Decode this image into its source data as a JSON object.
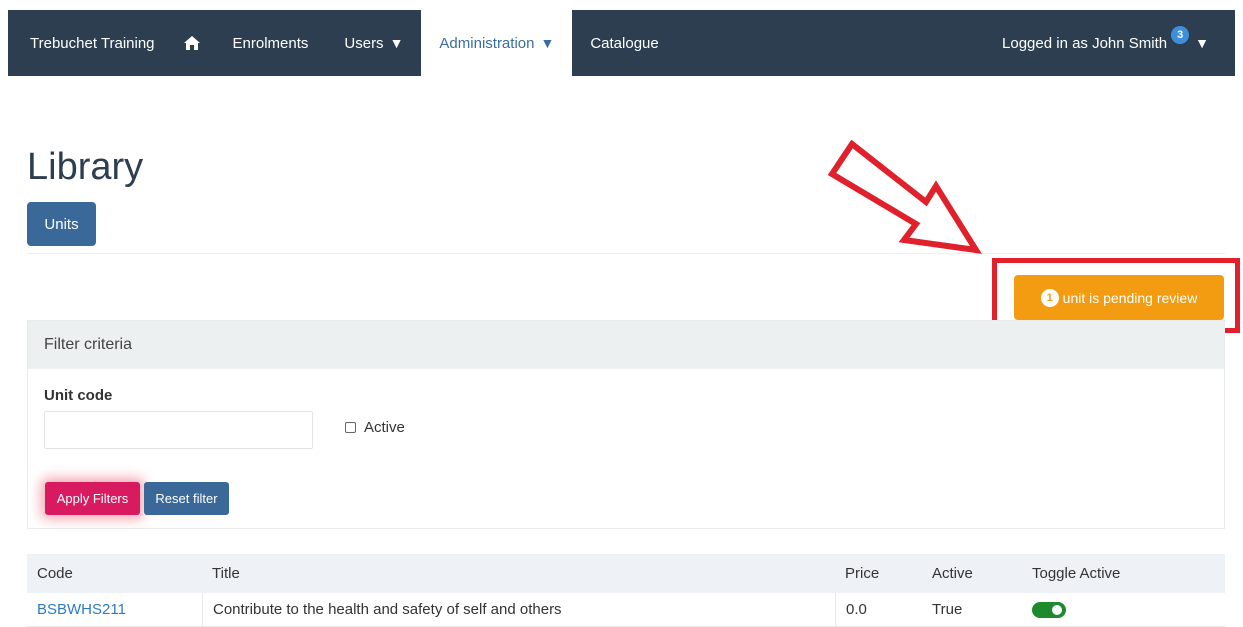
{
  "navbar": {
    "brand": "Trebuchet Training",
    "home_icon": "home-icon",
    "items": [
      {
        "label": "Enrolments",
        "caret": ""
      },
      {
        "label": "Users",
        "caret": "▼"
      },
      {
        "label": "Administration",
        "caret": "▼"
      },
      {
        "label": "Catalogue",
        "caret": ""
      }
    ],
    "user_label": "Logged in as John Smith",
    "notification_count": "3",
    "user_caret": "▼"
  },
  "page": {
    "title": "Library",
    "units_button": "Units"
  },
  "pending": {
    "count": "1",
    "label": "unit is pending review"
  },
  "filter": {
    "header": "Filter criteria",
    "unit_code_label": "Unit code",
    "unit_code_value": "",
    "active_label": "Active",
    "apply_button": "Apply Filters",
    "reset_button": "Reset filter"
  },
  "table": {
    "headers": [
      "Code",
      "Title",
      "Price",
      "Active",
      "Toggle Active"
    ],
    "rows": [
      {
        "code": "BSBWHS211",
        "title": "Contribute to the health and safety of self and others",
        "price": "0.0",
        "active": "True",
        "toggle": true
      }
    ]
  },
  "colors": {
    "navbar": "#2c3e50",
    "primary": "#3a6898",
    "warning": "#f39c12",
    "highlight": "#e0202a",
    "apply": "#d81b60",
    "toggle_on": "#1e8a2e"
  }
}
